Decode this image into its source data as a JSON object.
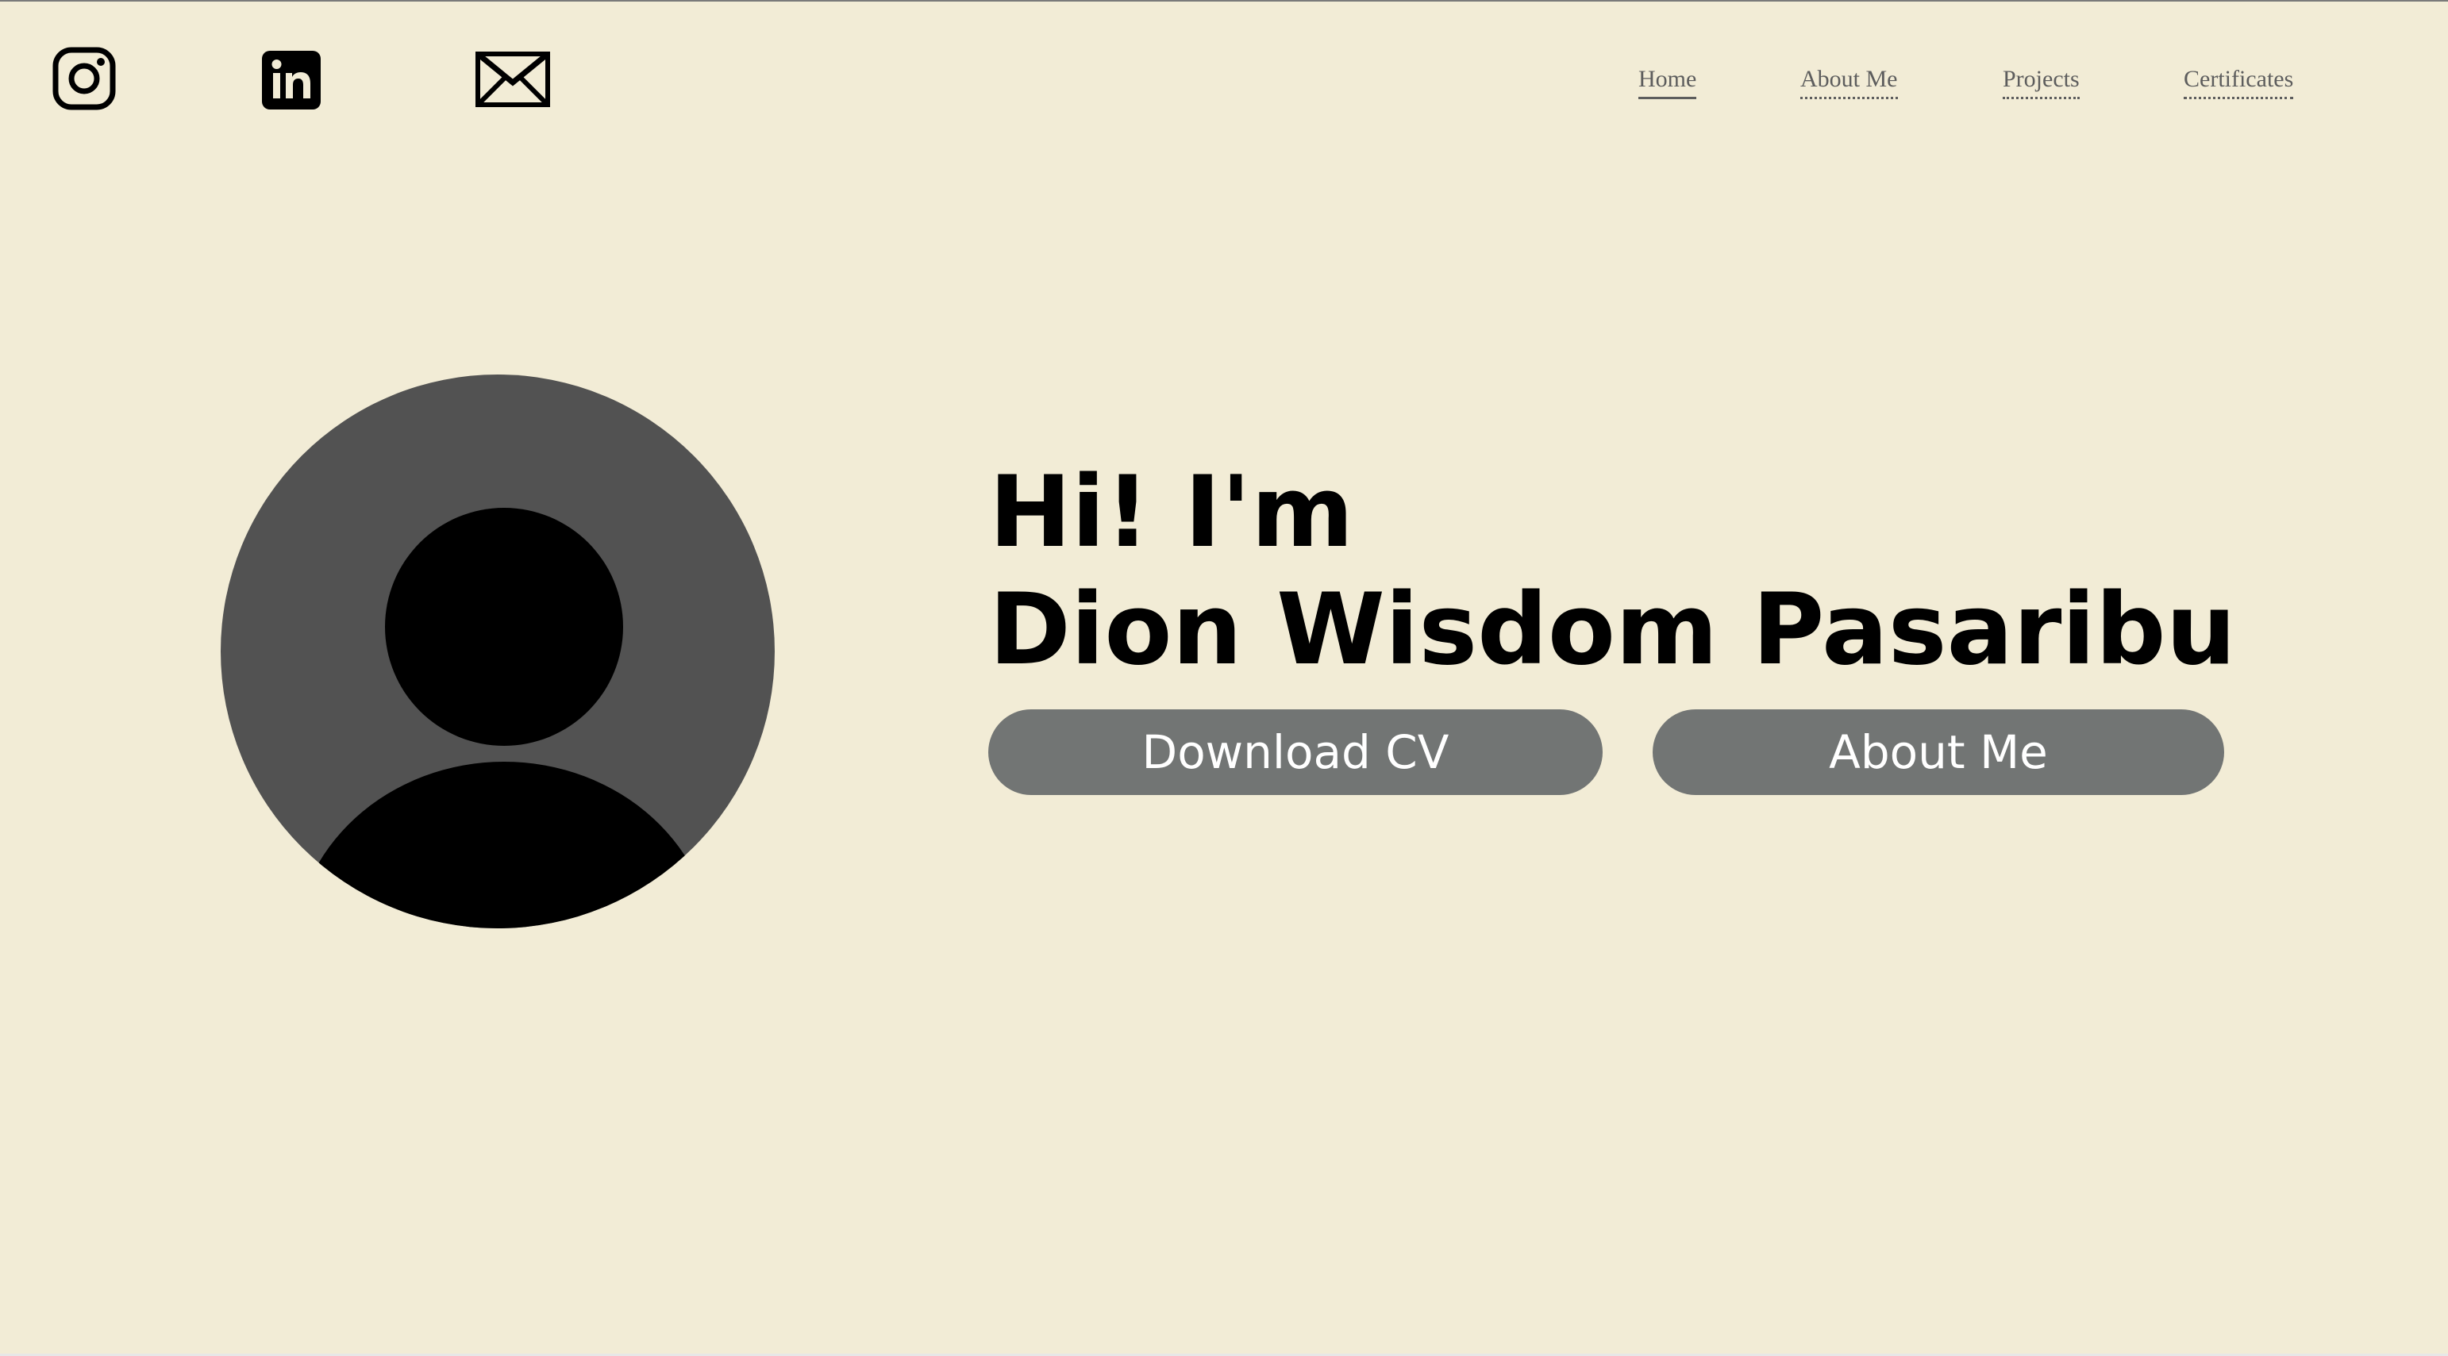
{
  "header": {
    "social": [
      {
        "icon": "instagram-icon"
      },
      {
        "icon": "linkedin-icon"
      },
      {
        "icon": "mail-icon"
      }
    ],
    "nav": [
      {
        "label": "Home",
        "state": "active"
      },
      {
        "label": "About Me"
      },
      {
        "label": "Projects"
      },
      {
        "label": "Certificates"
      }
    ]
  },
  "hero": {
    "greeting": "Hi! I'm",
    "name": "Dion Wisdom Pasaribu",
    "buttons": {
      "download_cv": "Download CV",
      "about_me": "About Me"
    },
    "avatar_icon": "user-silhouette-icon"
  },
  "colors": {
    "background": "#f2ecd6",
    "button": "#727574",
    "avatar_circle": "#525252",
    "nav_text": "#5d5d5d"
  }
}
